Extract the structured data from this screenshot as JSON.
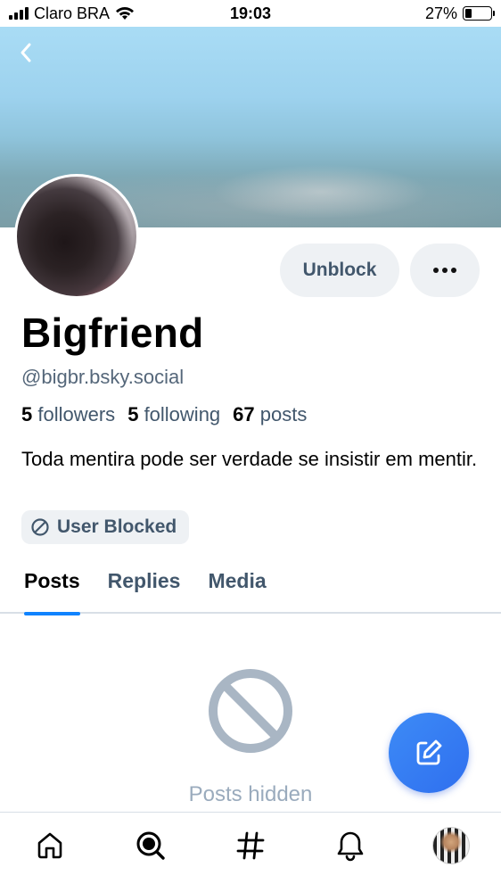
{
  "status_bar": {
    "carrier": "Claro BRA",
    "time": "19:03",
    "battery_percent": "27%",
    "battery_level": 0.27,
    "icons": [
      "signal-icon",
      "wifi-icon",
      "battery-icon"
    ]
  },
  "header": {
    "back_icon": "chevron-left-icon"
  },
  "profile": {
    "display_name": "Bigfriend",
    "handle": "@bigbr.bsky.social",
    "stats": {
      "followers_count": "5",
      "followers_label": "followers",
      "following_count": "5",
      "following_label": "following",
      "posts_count": "67",
      "posts_label": "posts"
    },
    "bio": "Toda mentira pode ser verdade se insistir em mentir.",
    "blocked_badge": "User Blocked",
    "blocked_icon": "block-icon"
  },
  "actions": {
    "unblock_label": "Unblock",
    "more_icon": "ellipsis-icon"
  },
  "tabs": [
    {
      "label": "Posts",
      "active": true
    },
    {
      "label": "Replies",
      "active": false
    },
    {
      "label": "Media",
      "active": false
    }
  ],
  "empty_state": {
    "icon": "block-icon",
    "text": "Posts hidden"
  },
  "fab": {
    "icon": "compose-icon"
  },
  "bottom_nav": {
    "items": [
      "home-icon",
      "search-icon",
      "hashtag-icon",
      "bell-icon",
      "profile-avatar"
    ]
  },
  "colors": {
    "accent": "#1083fe",
    "fab": "#3a82f5",
    "muted_text": "#42576c",
    "secondary_text": "#55677a",
    "button_bg": "#eef1f4"
  }
}
